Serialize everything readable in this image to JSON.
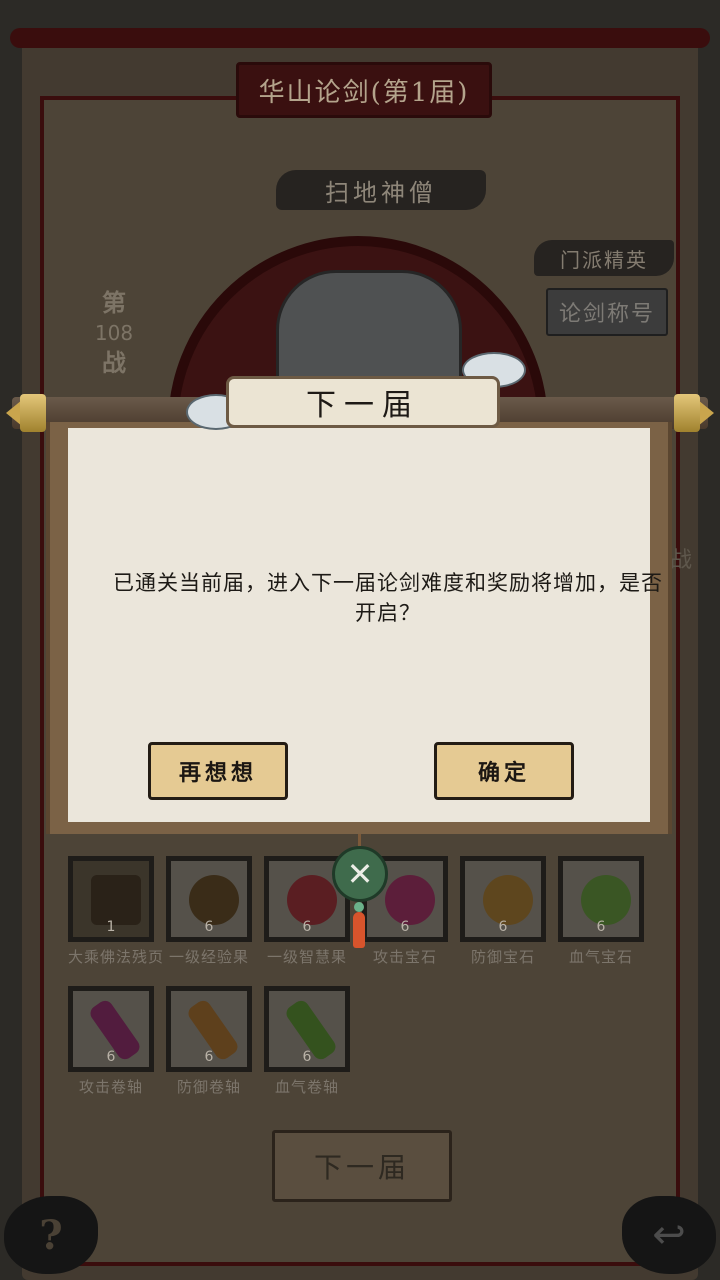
{
  "header": {
    "title": "华山论剑(第1届)"
  },
  "opponent": {
    "name": "扫地神僧"
  },
  "battle": {
    "line1": "第",
    "number": "108",
    "line3": "战"
  },
  "sect": {
    "tag": "门派精英",
    "title_button": "论剑称号"
  },
  "rewards": [
    {
      "name": "大乘佛法残页",
      "count": "1",
      "color": "#6b5a3a"
    },
    {
      "name": "一级经验果",
      "count": "6",
      "color": "#5e4a2a"
    },
    {
      "name": "一级智慧果",
      "count": "6",
      "color": "#8a2b2b"
    },
    {
      "name": "攻击宝石",
      "count": "6",
      "color": "#8a2a4f"
    },
    {
      "name": "防御宝石",
      "count": "6",
      "color": "#8a6426"
    },
    {
      "name": "血气宝石",
      "count": "6",
      "color": "#4e7a2e"
    },
    {
      "name": "攻击卷轴",
      "count": "6",
      "color": "#7a2a5a"
    },
    {
      "name": "防御卷轴",
      "count": "6",
      "color": "#8a5e26"
    },
    {
      "name": "血气卷轴",
      "count": "6",
      "color": "#4a7a2a"
    }
  ],
  "next_button": {
    "label": "下一届"
  },
  "help": {
    "glyph": "?"
  },
  "back": {
    "glyph": "↩"
  },
  "side_glyph": "战",
  "dialog": {
    "title": "下一届",
    "message": "已通关当前届，进入下一届论剑难度和奖励将增加，是否开启？",
    "cancel_label": "再想想",
    "confirm_label": "确定",
    "close_glyph": "✕"
  }
}
